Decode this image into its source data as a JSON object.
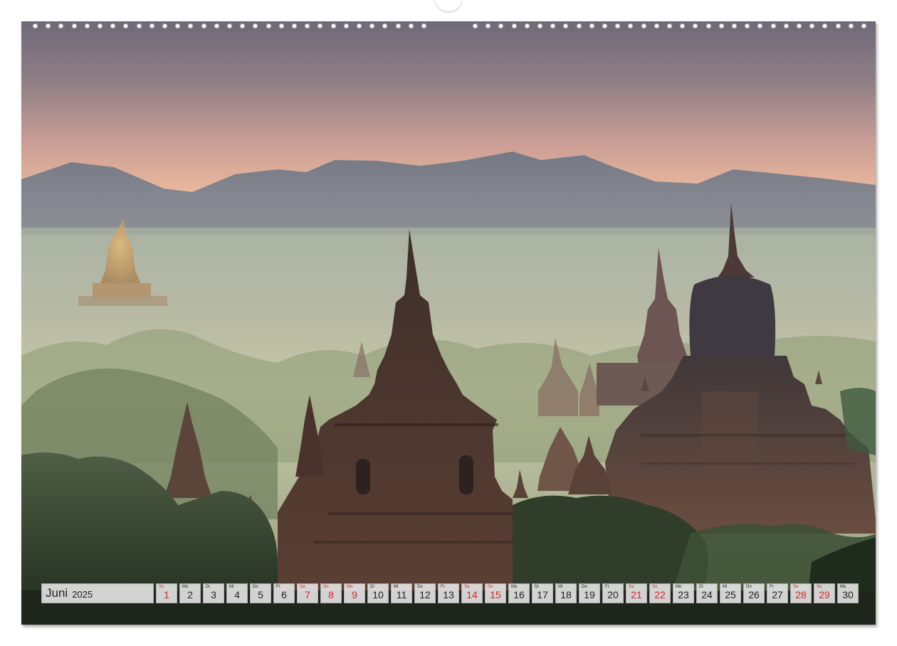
{
  "calendar": {
    "month": "Juni",
    "year": "2025",
    "days": [
      {
        "weekday": "So",
        "num": "1",
        "red": true
      },
      {
        "weekday": "Mo",
        "num": "2",
        "red": false
      },
      {
        "weekday": "Di",
        "num": "3",
        "red": false
      },
      {
        "weekday": "Mi",
        "num": "4",
        "red": false
      },
      {
        "weekday": "Do",
        "num": "5",
        "red": false
      },
      {
        "weekday": "Fr",
        "num": "6",
        "red": false
      },
      {
        "weekday": "Sa",
        "num": "7",
        "red": true
      },
      {
        "weekday": "So",
        "num": "8",
        "red": true
      },
      {
        "weekday": "Mo",
        "num": "9",
        "red": true
      },
      {
        "weekday": "Di",
        "num": "10",
        "red": false
      },
      {
        "weekday": "Mi",
        "num": "11",
        "red": false
      },
      {
        "weekday": "Do",
        "num": "12",
        "red": false
      },
      {
        "weekday": "Fr",
        "num": "13",
        "red": false
      },
      {
        "weekday": "Sa",
        "num": "14",
        "red": true
      },
      {
        "weekday": "So",
        "num": "15",
        "red": true
      },
      {
        "weekday": "Mo",
        "num": "16",
        "red": false
      },
      {
        "weekday": "Di",
        "num": "17",
        "red": false
      },
      {
        "weekday": "Mi",
        "num": "18",
        "red": false
      },
      {
        "weekday": "Do",
        "num": "19",
        "red": false
      },
      {
        "weekday": "Fr",
        "num": "20",
        "red": false
      },
      {
        "weekday": "Sa",
        "num": "21",
        "red": true
      },
      {
        "weekday": "So",
        "num": "22",
        "red": true
      },
      {
        "weekday": "Mo",
        "num": "23",
        "red": false
      },
      {
        "weekday": "Di",
        "num": "24",
        "red": false
      },
      {
        "weekday": "Mi",
        "num": "25",
        "red": false
      },
      {
        "weekday": "Do",
        "num": "26",
        "red": false
      },
      {
        "weekday": "Fr",
        "num": "27",
        "red": false
      },
      {
        "weekday": "Sa",
        "num": "28",
        "red": true
      },
      {
        "weekday": "So",
        "num": "29",
        "red": true
      },
      {
        "weekday": "Mo",
        "num": "30",
        "red": false
      }
    ]
  },
  "colors": {
    "holiday": "#d9272e",
    "normal": "#222222",
    "sky_top": "#6f6a78",
    "sky_glow": "#e9b79a",
    "mist": "#b9c0a6",
    "temple": "#4a342c"
  },
  "icons": {
    "binding": "spiral-binding-holes",
    "hanger": "hanger-notch"
  }
}
